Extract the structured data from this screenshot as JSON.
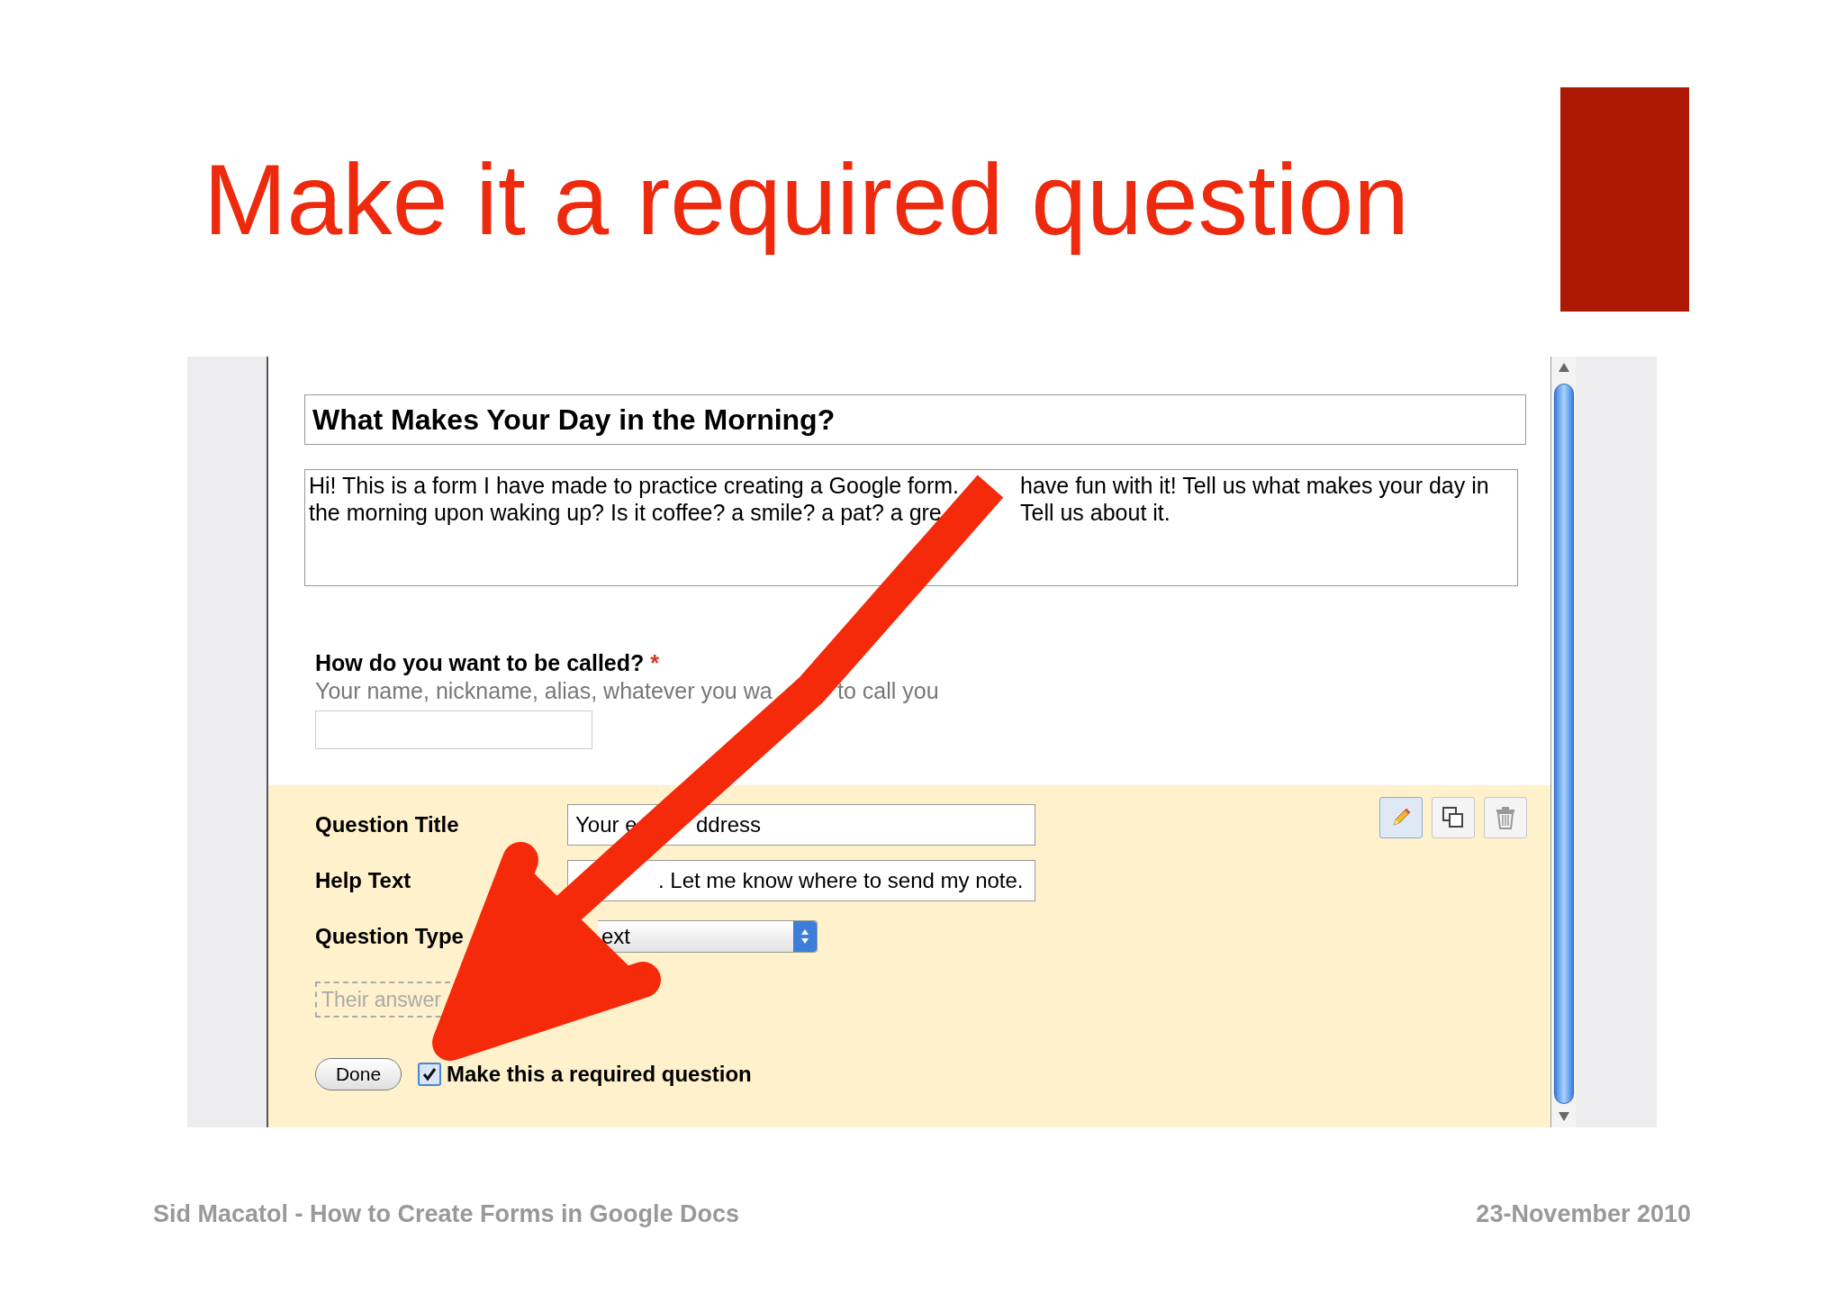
{
  "slide": {
    "title": "Make it a required question",
    "footer_left": "Sid Macatol - How to Create Forms in Google Docs",
    "footer_right": "23-November 2010"
  },
  "form": {
    "title": "What Makes Your Day in the Morning?",
    "description_lines": [
      [
        "Hi! This is a form I have made to practice creating a Google form.",
        "have fun with it! Tell us what makes your day in"
      ],
      [
        "the morning upon waking up? Is it coffee? a smile? a pat? a gre",
        "Tell us about it."
      ]
    ]
  },
  "question": {
    "title": "How do you want to be called?",
    "required_mark": "*",
    "help_fragments": [
      "Your name, nickname, alias, whatever you wa",
      "to call you"
    ]
  },
  "editor": {
    "fields": [
      {
        "kind": "text",
        "label": "Question Title",
        "value_fragments": [
          "Your e",
          "ddress"
        ]
      },
      {
        "kind": "text",
        "label": "Help Text",
        "value_fragments": [
          ". Let me know where to send my note."
        ]
      },
      {
        "kind": "select",
        "label": "Question Type",
        "value_fragments": [
          "ext"
        ]
      }
    ],
    "tools": [
      {
        "kind": "edit",
        "selected": true
      },
      {
        "kind": "duplicate",
        "selected": false
      },
      {
        "kind": "delete",
        "selected": false
      }
    ],
    "preview_placeholder": "Their answer",
    "done": "Done",
    "required": {
      "label": "Make this a required question",
      "checked": true
    }
  }
}
